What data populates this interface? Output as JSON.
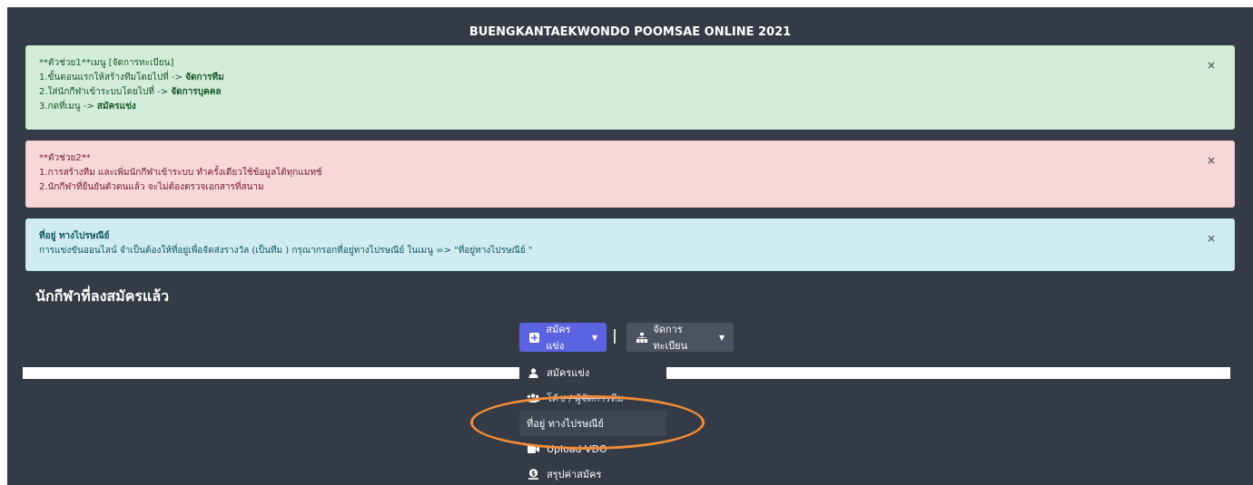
{
  "page": {
    "title": "BUENGKANTAEKWONDO POOMSAE ONLINE 2021",
    "section_heading": "นักกีฬาที่ลงสมัครแล้ว"
  },
  "alerts": {
    "green": {
      "line1": "**ตัวช่วย1**เมนู [จัดการทะเบียน]",
      "line2_prefix": "1.ขั้นตอนแรกให้สร้างทีมโดยไปที่ -> ",
      "line2_bold": "จัดการทีม",
      "line3_prefix": "2.ใส่นักกีฬาเข้าระบบโดยไปที่ -> ",
      "line3_bold": "จัดการบุคคล",
      "line4_prefix": "3.กดที่เมนู -> ",
      "line4_bold": "สมัครแข่ง",
      "close": "×"
    },
    "red": {
      "line1": "**ตัวช่วย2**",
      "line2": "1.การสร้างทีม และเพิ่มนักกีฬาเข้าระบบ ทำครั้งเดียวใช้ข้อมูลได้ทุกแมทช์",
      "line3": "2.นักกีฬาที่ยืนยันตัวตนแล้ว จะไม่ต้องตรวจเอกสารที่สนาม",
      "close": "×"
    },
    "blue": {
      "line1": "ที่อยู่ ทางไปรษณีย์",
      "line2": "การแข่งขันออนไลน์ จำเป็นต้องให้ที่อยู่เพื่อจัดส่งรางวัล (เป็นทีม ) กรุณากรอกที่อยู่ทางไปรษณีย์ ในเมนู => \"ที่อยู่ทางไปรษณีย์ \"",
      "close": "×"
    }
  },
  "toolbar": {
    "register_label": "สมัครแข่ง",
    "manage_label": "จัดการทะเบียน",
    "separator": "|"
  },
  "dropdown": {
    "items": [
      {
        "label": "สมัครแข่ง",
        "icon": "user-icon"
      },
      {
        "label": "โค้ช / ผู้จัดการทีม",
        "icon": "users-icon"
      },
      {
        "label": "ที่อยู่ ทางไปรษณีย์",
        "icon": "none"
      },
      {
        "label": "Upload VDO",
        "icon": "video-icon"
      },
      {
        "label": "สรุปค่าสมัคร",
        "icon": "money-icon"
      }
    ]
  },
  "colors": {
    "background": "#343a46",
    "primary_button": "#5b63e0",
    "secondary_button": "#4c5260",
    "highlight": "#f28c38"
  }
}
